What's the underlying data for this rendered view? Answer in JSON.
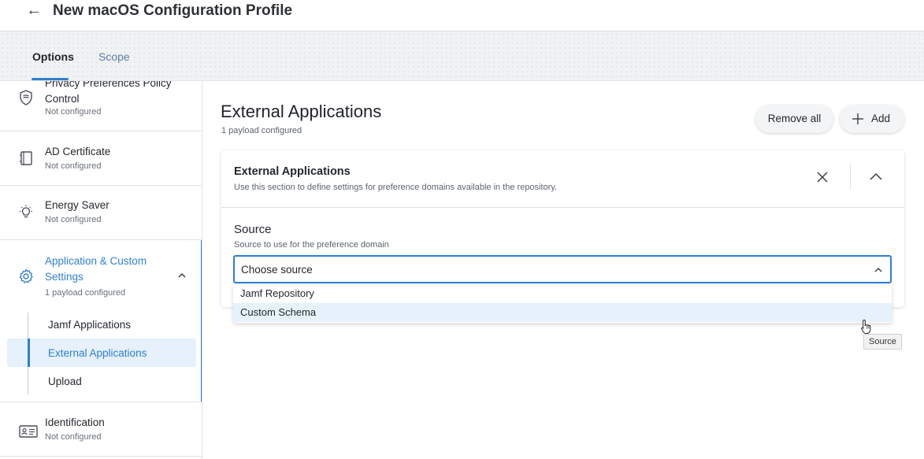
{
  "header": {
    "back_glyph": "←",
    "title": "New macOS Configuration Profile"
  },
  "tabs": [
    {
      "label": "Options",
      "active": true
    },
    {
      "label": "Scope",
      "active": false
    }
  ],
  "sidebar": {
    "items": [
      {
        "name": "Privacy Preferences Policy Control",
        "status": "Not configured",
        "icon": "shield-icon"
      },
      {
        "name": "AD Certificate",
        "status": "Not configured",
        "icon": "certificate-icon"
      },
      {
        "name": "Energy Saver",
        "status": "Not configured",
        "icon": "lightbulb-icon"
      },
      {
        "name": "Application & Custom Settings",
        "status": "1 payload configured",
        "icon": "gear-icon",
        "expanded": true,
        "children": [
          {
            "label": "Jamf Applications"
          },
          {
            "label": "External Applications",
            "active": true
          },
          {
            "label": "Upload"
          }
        ]
      },
      {
        "name": "Identification",
        "status": "Not configured",
        "icon": "id-card-icon"
      }
    ]
  },
  "main": {
    "title": "External Applications",
    "subtitle": "1 payload configured",
    "remove_all_label": "Remove all",
    "add_label": "Add"
  },
  "card": {
    "title": "External Applications",
    "description": "Use this section to define settings for preference domains available in the repository.",
    "field": {
      "label": "Source",
      "help": "Source to use for the preference domain",
      "placeholder": "Choose source",
      "options": [
        "Jamf Repository",
        "Custom Schema"
      ],
      "highlighted_option": "Custom Schema"
    }
  },
  "tooltip": "Source",
  "colors": {
    "accent": "#2f7fd1",
    "highlight": "#e6f1fb"
  }
}
